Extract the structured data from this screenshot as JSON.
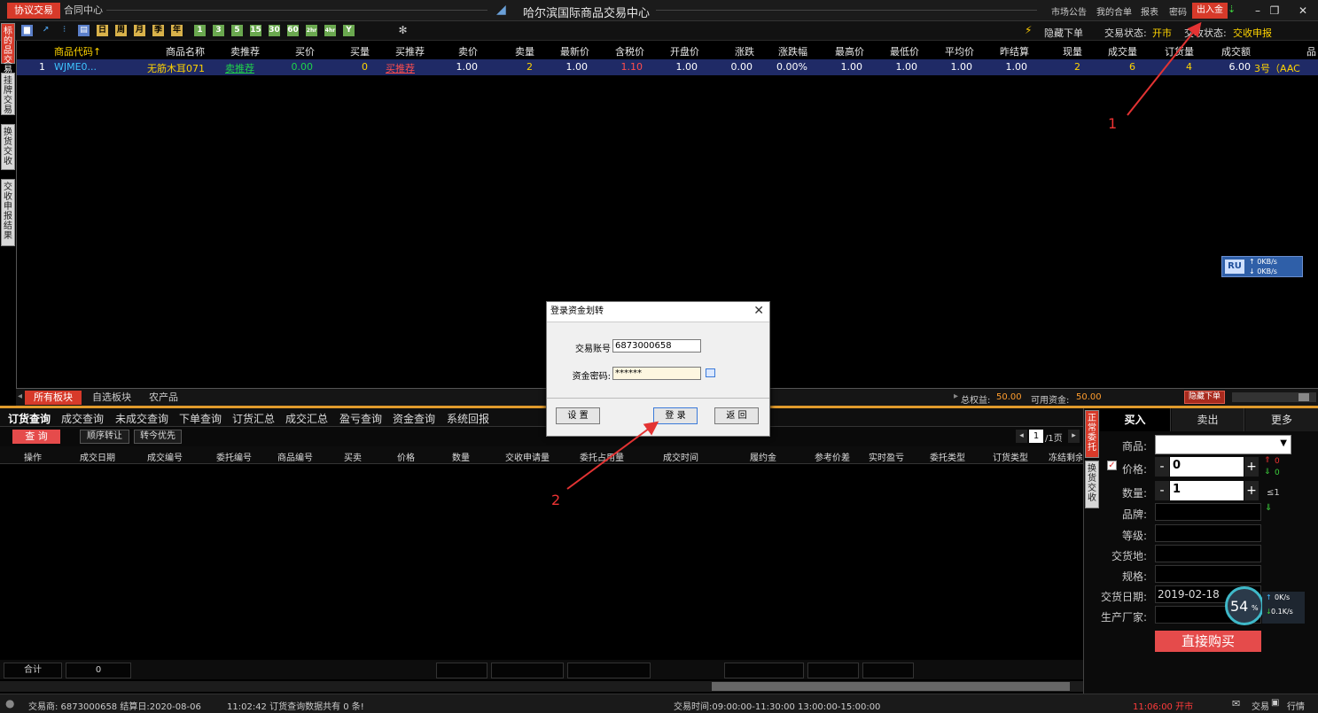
{
  "titlebar": {
    "tab_active": "协议交易",
    "tab_contract": "合同中心",
    "title": "哈尔滨国际商品交易中心",
    "links": [
      "市场公告",
      "我的合单",
      "报表",
      "密码"
    ],
    "deposit_button": "出入金"
  },
  "toolbar": {
    "period_buttons": [
      "日",
      "周",
      "月",
      "季",
      "年"
    ],
    "minute_buttons": [
      "1",
      "3",
      "5",
      "15",
      "30",
      "60",
      "2hr",
      "4hr",
      "Y"
    ],
    "hide_order": "隐藏下单",
    "trade_status_label": "交易状态:",
    "trade_status_value": "开市",
    "delivery_status_label": "交收状态:",
    "delivery_status_value": "交收申报"
  },
  "side_tabs": [
    "标的品交易",
    "挂牌交易",
    "换货交收",
    "交收申报结果"
  ],
  "grid": {
    "headers": [
      "商品代码↑",
      "商品名称",
      "卖推荐",
      "买价",
      "买量",
      "买推荐",
      "卖价",
      "卖量",
      "最新价",
      "含税价",
      "开盘价",
      "涨跌",
      "涨跌幅",
      "最高价",
      "最低价",
      "平均价",
      "昨结算",
      "现量",
      "成交量",
      "订货量",
      "成交额",
      "品"
    ],
    "rows": [
      {
        "idx": "1",
        "code": "WJME0...",
        "name": "无筋木耳071",
        "sell_rec": "卖推荐",
        "bid": "0.00",
        "bid_qty": "0",
        "buy_rec": "买推荐",
        "ask": "1.00",
        "ask_qty": "2",
        "last": "1.00",
        "tax_price": "1.10",
        "open": "1.00",
        "change": "0.00",
        "change_pct": "0.00%",
        "high": "1.00",
        "low": "1.00",
        "avg": "1.00",
        "prev_settle": "1.00",
        "cur_qty": "2",
        "volume": "6",
        "order_qty": "4",
        "amount": "6.00",
        "brand": "3号（AAC"
      }
    ]
  },
  "net_widget": {
    "badge": "RU",
    "up": "↑ 0KB/s",
    "down": "↓ 0KB/s"
  },
  "board_tabs": [
    "所有板块",
    "自选板块",
    "农产品"
  ],
  "equity": {
    "total_label": "总权益:",
    "total_value": "50.00",
    "avail_label": "可用资金:",
    "avail_value": "50.00",
    "hide_order": "隐藏下单"
  },
  "query_tabs": [
    "订货查询",
    "成交查询",
    "未成交查询",
    "下单查询",
    "订货汇总",
    "成交汇总",
    "盈亏查询",
    "资金查询",
    "系统回报"
  ],
  "query_bar": {
    "query": "查 询",
    "order_transfer": "顺序转让",
    "transfer_priority": "转今优先",
    "page_value": "1",
    "page_suffix": "/1页"
  },
  "query_headers": [
    "操作",
    "成交日期",
    "成交编号",
    "委托编号",
    "商品编号",
    "买卖",
    "价格",
    "数量",
    "交收申请量",
    "委托占用量",
    "成交时间",
    "履约金",
    "参考价差",
    "实时盈亏",
    "委托类型",
    "订货类型",
    "冻结剩余"
  ],
  "query_sum": {
    "label": "合计",
    "value": "0"
  },
  "right_panel": {
    "tabs": [
      "买入",
      "卖出",
      "更多"
    ],
    "side_tabs": [
      "正常委托",
      "换货交收"
    ],
    "product_label": "商品:",
    "price_label": "价格:",
    "price_value": "0",
    "qty_label": "数量:",
    "qty_value": "1",
    "qty_hint": "≤1",
    "price_up": "0",
    "price_down": "0",
    "brand_label": "品牌:",
    "grade_label": "等级:",
    "place_label": "交货地:",
    "spec_label": "规格:",
    "date_label": "交货日期:",
    "date_value": "2019-02-18",
    "maker_label": "生产厂家:",
    "buy_button": "直接购买",
    "gauge": "54",
    "gauge_unit": "%",
    "speed_up": "0K/s",
    "speed_down": "0.1K/s"
  },
  "status": {
    "broker": "交易商: 6873000658 结算日:2020-08-06",
    "message": "11:02:42 订货查询数据共有 0 条!",
    "hours": "交易时间:09:00:00-11:30:00   13:00:00-15:00:00",
    "clock": "11:06:00 开市",
    "trade": "交易",
    "quote": "行情"
  },
  "dialog": {
    "title": "登录资金划转",
    "account_label": "交易账号",
    "account_value": "6873000658",
    "password_label": "资金密码:",
    "password_value": "******",
    "settings": "设 置",
    "login": "登 录",
    "back": "返 回"
  },
  "annotations": {
    "one": "1",
    "two": "2",
    "color": "#e33333"
  }
}
